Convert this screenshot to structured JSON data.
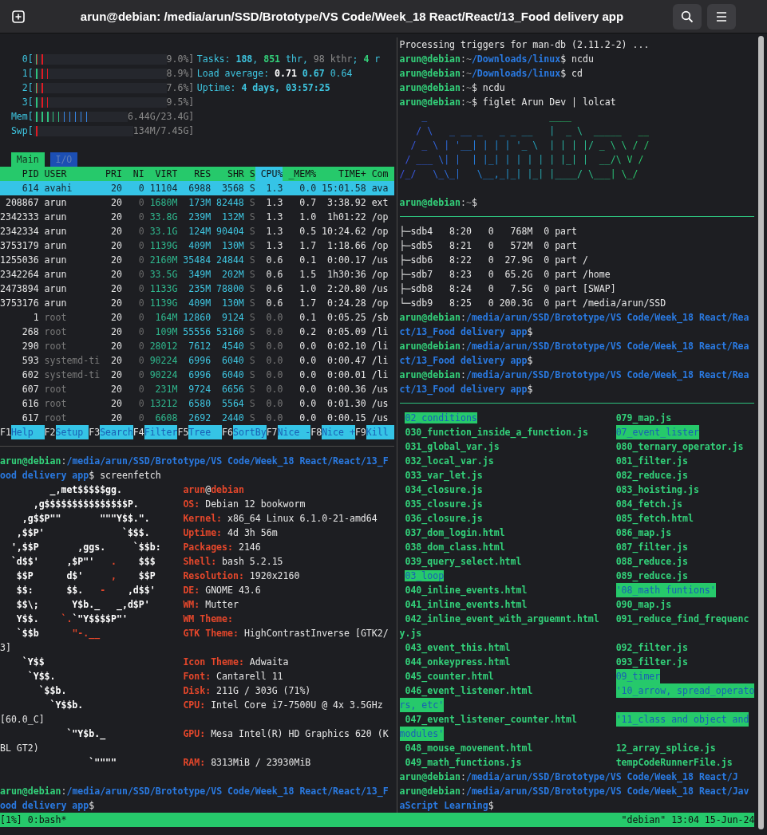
{
  "window": {
    "title": "arun@debian: /media/arun/SSD/Brototype/VS Code/Week_18 React/React/13_Food delivery app"
  },
  "htop": {
    "meters": [
      {
        "label": "0[",
        "kind": "cpu",
        "level": 0.09,
        "value": "9.0%]"
      },
      {
        "label": "1[",
        "kind": "cpu",
        "level": 0.11,
        "value": "8.9%]"
      },
      {
        "label": "2[",
        "kind": "cpu",
        "level": 0.08,
        "value": "7.6%]"
      },
      {
        "label": "3[",
        "kind": "cpu",
        "level": 0.11,
        "value": "9.5%]"
      },
      {
        "label": "Mem[",
        "kind": "mem",
        "level": 0.6,
        "value": "6.44G/23.4G]"
      },
      {
        "label": "Swp[",
        "kind": "swap",
        "level": 0.08,
        "value": "134M/7.45G]"
      }
    ],
    "info": [
      [
        {
          "kind": "cyan",
          "text": "Tasks: "
        },
        {
          "kind": "cyanb",
          "text": "188"
        },
        {
          "kind": "cyan",
          "text": ", "
        },
        {
          "kind": "greenb",
          "text": "851"
        },
        {
          "kind": "cyan",
          "text": " thr, "
        },
        {
          "kind": "dim",
          "text": "98 kthr"
        },
        {
          "kind": "cyan",
          "text": "; "
        },
        {
          "kind": "greenb",
          "text": "4"
        },
        {
          "kind": "cyan",
          "text": " r"
        }
      ],
      [
        {
          "kind": "cyan",
          "text": "Load average: "
        },
        {
          "kind": "whiteb",
          "text": "0.71"
        },
        {
          "kind": "cyanb",
          "text": " 0.67"
        },
        {
          "kind": "cyan",
          "text": " 0.64"
        }
      ],
      [
        {
          "kind": "cyan",
          "text": "Uptime: "
        },
        {
          "kind": "cyanb",
          "text": "4 days, 03:57:25"
        }
      ]
    ],
    "tabs": [
      {
        "label": "Main",
        "selected": true
      },
      {
        "label": "I/O",
        "selected": false
      }
    ],
    "columns": [
      {
        "label": "PID",
        "selected": false
      },
      {
        "label": "USER",
        "selected": false
      },
      {
        "label": "PRI",
        "selected": false
      },
      {
        "label": "NI",
        "selected": false
      },
      {
        "label": "VIRT",
        "selected": false
      },
      {
        "label": "RES",
        "selected": false
      },
      {
        "label": "SHR",
        "selected": false
      },
      {
        "label": "S",
        "selected": false
      },
      {
        "label": "CPU%",
        "selected": true
      },
      {
        "label": "_MEM%",
        "selected": false
      },
      {
        "label": "TIME+",
        "selected": false
      },
      {
        "label": "Com",
        "selected": false
      }
    ],
    "rows": [
      {
        "cells": [
          "614",
          "avahi",
          "20",
          "0",
          "11104",
          "6988",
          "3568",
          "S",
          "1.3",
          "0.0",
          "15:01.58",
          "ava"
        ],
        "selected": true,
        "dimmed": false
      },
      {
        "cells": [
          "208867",
          "arun",
          "20",
          "0",
          "1680M",
          "173M",
          "82448",
          "S",
          "1.3",
          "0.7",
          "3:38.92",
          "ext"
        ],
        "selected": false,
        "dimmed": false
      },
      {
        "cells": [
          "2342333",
          "arun",
          "20",
          "0",
          "33.8G",
          "239M",
          "132M",
          "S",
          "1.3",
          "1.0",
          "1h01:22",
          "/op"
        ],
        "selected": false,
        "dimmed": false
      },
      {
        "cells": [
          "2342334",
          "arun",
          "20",
          "0",
          "33.1G",
          "124M",
          "90404",
          "S",
          "1.3",
          "0.5",
          "10:24.62",
          "/op"
        ],
        "selected": false,
        "dimmed": false
      },
      {
        "cells": [
          "3753179",
          "arun",
          "20",
          "0",
          "1139G",
          "409M",
          "130M",
          "S",
          "1.3",
          "1.7",
          "1:18.66",
          "/op"
        ],
        "selected": false,
        "dimmed": false
      },
      {
        "cells": [
          "1255036",
          "arun",
          "20",
          "0",
          "2160M",
          "35484",
          "24844",
          "S",
          "0.6",
          "0.1",
          "0:00.17",
          "/us"
        ],
        "selected": false,
        "dimmed": false
      },
      {
        "cells": [
          "2342264",
          "arun",
          "20",
          "0",
          "33.5G",
          "349M",
          "202M",
          "S",
          "0.6",
          "1.5",
          "1h30:36",
          "/op"
        ],
        "selected": false,
        "dimmed": false
      },
      {
        "cells": [
          "2473894",
          "arun",
          "20",
          "0",
          "1133G",
          "235M",
          "78800",
          "S",
          "0.6",
          "1.0",
          "2:20.80",
          "/us"
        ],
        "selected": false,
        "dimmed": false
      },
      {
        "cells": [
          "3753176",
          "arun",
          "20",
          "0",
          "1139G",
          "409M",
          "130M",
          "S",
          "0.6",
          "1.7",
          "0:24.28",
          "/op"
        ],
        "selected": false,
        "dimmed": false
      },
      {
        "cells": [
          "1",
          "root",
          "20",
          "0",
          "164M",
          "12860",
          "9124",
          "S",
          "0.0",
          "0.1",
          "0:05.25",
          "/sb"
        ],
        "selected": false,
        "dimmed": true
      },
      {
        "cells": [
          "268",
          "root",
          "20",
          "0",
          "109M",
          "55556",
          "53160",
          "S",
          "0.0",
          "0.2",
          "0:05.09",
          "/li"
        ],
        "selected": false,
        "dimmed": true
      },
      {
        "cells": [
          "290",
          "root",
          "20",
          "0",
          "28012",
          "7612",
          "4540",
          "S",
          "0.0",
          "0.0",
          "0:02.10",
          "/li"
        ],
        "selected": false,
        "dimmed": true
      },
      {
        "cells": [
          "593",
          "systemd-ti",
          "20",
          "0",
          "90224",
          "6996",
          "6040",
          "S",
          "0.0",
          "0.0",
          "0:00.47",
          "/li"
        ],
        "selected": false,
        "dimmed": true
      },
      {
        "cells": [
          "602",
          "systemd-ti",
          "20",
          "0",
          "90224",
          "6996",
          "6040",
          "S",
          "0.0",
          "0.0",
          "0:00.01",
          "/li"
        ],
        "selected": false,
        "dimmed": true
      },
      {
        "cells": [
          "607",
          "root",
          "20",
          "0",
          "231M",
          "9724",
          "6656",
          "S",
          "0.0",
          "0.0",
          "0:00.36",
          "/us"
        ],
        "selected": false,
        "dimmed": true
      },
      {
        "cells": [
          "616",
          "root",
          "20",
          "0",
          "13212",
          "6580",
          "5564",
          "S",
          "0.0",
          "0.0",
          "0:01.30",
          "/us"
        ],
        "selected": false,
        "dimmed": true
      },
      {
        "cells": [
          "617",
          "root",
          "20",
          "0",
          "6608",
          "2692",
          "2440",
          "S",
          "0.0",
          "0.0",
          "0:00.15",
          "/us"
        ],
        "selected": false,
        "dimmed": true
      }
    ],
    "keys": [
      {
        "key": "F1",
        "label": "Help"
      },
      {
        "key": "F2",
        "label": "Setup"
      },
      {
        "key": "F3",
        "label": "Search"
      },
      {
        "key": "F4",
        "label": "Filter"
      },
      {
        "key": "F5",
        "label": "Tree"
      },
      {
        "key": "F6",
        "label": "SortBy"
      },
      {
        "key": "F7",
        "label": "Nice -"
      },
      {
        "key": "F8",
        "label": "Nice +"
      },
      {
        "key": "F9",
        "label": "Kill"
      }
    ]
  },
  "left_bottom": {
    "lines": [
      {
        "kind": "text",
        "segs": [
          {
            "kind": "user",
            "text": "arun@debian"
          },
          {
            "kind": "sep",
            "text": ":"
          },
          {
            "kind": "path",
            "text": "/media/arun/SSD/Brototype/VS Code/Week_18 React/React/13_F"
          }
        ]
      },
      {
        "kind": "text",
        "segs": [
          {
            "kind": "path",
            "text": "ood delivery app"
          },
          {
            "kind": "plain",
            "text": "$ screenfetch"
          }
        ]
      },
      {
        "kind": "split",
        "art": [
          {
            "kind": "art",
            "text": "         _,met$$$$$gg."
          }
        ],
        "info": [
          {
            "kind": "redb",
            "text": "arun"
          },
          {
            "kind": "plain",
            "text": "@"
          },
          {
            "kind": "redb",
            "text": "debian"
          }
        ]
      },
      {
        "kind": "split",
        "art": [
          {
            "kind": "art",
            "text": "      ,g$$$$$$$$$$$$$$$P."
          }
        ],
        "info": [
          {
            "kind": "redb",
            "text": "OS:"
          },
          {
            "kind": "plain",
            "text": " Debian 12 bookworm"
          }
        ]
      },
      {
        "kind": "split",
        "art": [
          {
            "kind": "art",
            "text": "    ,g$$P\"\"       \"\"\"Y$$.\"."
          }
        ],
        "info": [
          {
            "kind": "redb",
            "text": "Kernel:"
          },
          {
            "kind": "plain",
            "text": " x86_64 Linux 6.1.0-21-amd64"
          }
        ]
      },
      {
        "kind": "split",
        "art": [
          {
            "kind": "art",
            "text": "   ,$$P'              `$$$."
          }
        ],
        "info": [
          {
            "kind": "redb",
            "text": "Uptime:"
          },
          {
            "kind": "plain",
            "text": " 4d 3h 56m"
          }
        ]
      },
      {
        "kind": "split",
        "art": [
          {
            "kind": "art",
            "text": "  ',$$P       ,ggs.     `$$b:"
          }
        ],
        "info": [
          {
            "kind": "redb",
            "text": "Packages:"
          },
          {
            "kind": "plain",
            "text": " 2146"
          }
        ]
      },
      {
        "kind": "split",
        "art": [
          {
            "kind": "art",
            "text": "  `d$$'     ,$P\"'   "
          },
          {
            "kind": "artred",
            "text": "."
          },
          {
            "kind": "art",
            "text": "    $$$"
          }
        ],
        "info": [
          {
            "kind": "redb",
            "text": "Shell:"
          },
          {
            "kind": "plain",
            "text": " bash 5.2.15"
          }
        ]
      },
      {
        "kind": "split",
        "art": [
          {
            "kind": "art",
            "text": "   $$P      d$'     "
          },
          {
            "kind": "artred",
            "text": ","
          },
          {
            "kind": "art",
            "text": "    $$P"
          }
        ],
        "info": [
          {
            "kind": "redb",
            "text": "Resolution:"
          },
          {
            "kind": "plain",
            "text": " 1920x2160"
          }
        ]
      },
      {
        "kind": "split",
        "art": [
          {
            "kind": "art",
            "text": "   $$:      $$.   "
          },
          {
            "kind": "artred",
            "text": "-"
          },
          {
            "kind": "art",
            "text": "    ,d$$'"
          }
        ],
        "info": [
          {
            "kind": "redb",
            "text": "DE:"
          },
          {
            "kind": "plain",
            "text": " GNOME 43.6"
          }
        ]
      },
      {
        "kind": "split",
        "art": [
          {
            "kind": "art",
            "text": "   $$\\;      Y$b._   _,d$P'"
          }
        ],
        "info": [
          {
            "kind": "redb",
            "text": "WM:"
          },
          {
            "kind": "plain",
            "text": " Mutter"
          }
        ]
      },
      {
        "kind": "split",
        "art": [
          {
            "kind": "art",
            "text": "   Y$$.    "
          },
          {
            "kind": "artred",
            "text": "`."
          },
          {
            "kind": "art",
            "text": "`\"Y$$$$P\"'"
          }
        ],
        "info": [
          {
            "kind": "redb",
            "text": "WM Theme:"
          }
        ]
      },
      {
        "kind": "split",
        "art": [
          {
            "kind": "art",
            "text": "   `$$b      "
          },
          {
            "kind": "artred",
            "text": "\"-.__"
          }
        ],
        "info": [
          {
            "kind": "redb",
            "text": "GTK Theme:"
          },
          {
            "kind": "plain",
            "text": " HighContrastInverse [GTK2/"
          }
        ]
      },
      {
        "kind": "text",
        "segs": [
          {
            "kind": "plain",
            "text": "3]"
          }
        ]
      },
      {
        "kind": "split",
        "art": [
          {
            "kind": "art",
            "text": "    `Y$$"
          }
        ],
        "info": [
          {
            "kind": "redb",
            "text": "Icon Theme:"
          },
          {
            "kind": "plain",
            "text": " Adwaita"
          }
        ]
      },
      {
        "kind": "split",
        "art": [
          {
            "kind": "art",
            "text": "     `Y$$."
          }
        ],
        "info": [
          {
            "kind": "redb",
            "text": "Font:"
          },
          {
            "kind": "plain",
            "text": " Cantarell 11"
          }
        ]
      },
      {
        "kind": "split",
        "art": [
          {
            "kind": "art",
            "text": "       `$$b."
          }
        ],
        "info": [
          {
            "kind": "redb",
            "text": "Disk:"
          },
          {
            "kind": "plain",
            "text": " 211G / 303G (71%)"
          }
        ]
      },
      {
        "kind": "split",
        "art": [
          {
            "kind": "art",
            "text": "         `Y$$b."
          }
        ],
        "info": [
          {
            "kind": "redb",
            "text": "CPU:"
          },
          {
            "kind": "plain",
            "text": " Intel Core i7-7500U @ 4x 3.5GHz"
          }
        ]
      },
      {
        "kind": "text",
        "segs": [
          {
            "kind": "plain",
            "text": "[60.0_C]"
          }
        ]
      },
      {
        "kind": "split",
        "art": [
          {
            "kind": "art",
            "text": "            `\"Y$b._"
          }
        ],
        "info": [
          {
            "kind": "redb",
            "text": "GPU:"
          },
          {
            "kind": "plain",
            "text": " Mesa Intel(R) HD Graphics 620 (K"
          }
        ]
      },
      {
        "kind": "text",
        "segs": [
          {
            "kind": "plain",
            "text": "BL GT2)"
          }
        ]
      },
      {
        "kind": "split",
        "art": [
          {
            "kind": "art",
            "text": "                `\"\"\"\""
          }
        ],
        "info": [
          {
            "kind": "redb",
            "text": "RAM:"
          },
          {
            "kind": "plain",
            "text": " 8313MiB / 23930MiB"
          }
        ]
      },
      {
        "kind": "blank"
      },
      {
        "kind": "text",
        "segs": [
          {
            "kind": "user",
            "text": "arun@debian"
          },
          {
            "kind": "sep",
            "text": ":"
          },
          {
            "kind": "path",
            "text": "/media/arun/SSD/Brototype/VS Code/Week_18 React/React/13_F"
          }
        ]
      },
      {
        "kind": "text",
        "segs": [
          {
            "kind": "path",
            "text": "ood delivery app"
          },
          {
            "kind": "plain",
            "text": "$"
          }
        ]
      }
    ]
  },
  "right_top": {
    "lines": [
      {
        "kind": "text",
        "segs": [
          {
            "kind": "plain",
            "text": "Processing triggers for man-db (2.11.2-2) ..."
          }
        ]
      },
      {
        "kind": "text",
        "segs": [
          {
            "kind": "user",
            "text": "arun@debian"
          },
          {
            "kind": "sep",
            "text": ":"
          },
          {
            "kind": "dim",
            "text": "~"
          },
          {
            "kind": "path",
            "text": "/Downloads/linux"
          },
          {
            "kind": "plain",
            "text": "$ ncdu"
          }
        ]
      },
      {
        "kind": "text",
        "segs": [
          {
            "kind": "user",
            "text": "arun@debian"
          },
          {
            "kind": "sep",
            "text": ":"
          },
          {
            "kind": "dim",
            "text": "~"
          },
          {
            "kind": "path",
            "text": "/Downloads/linux"
          },
          {
            "kind": "plain",
            "text": "$ cd"
          }
        ]
      },
      {
        "kind": "text",
        "segs": [
          {
            "kind": "user",
            "text": "arun@debian"
          },
          {
            "kind": "sep",
            "text": ":"
          },
          {
            "kind": "dim",
            "text": "~"
          },
          {
            "kind": "plain",
            "text": "$ ncdu"
          }
        ]
      },
      {
        "kind": "text",
        "segs": [
          {
            "kind": "user",
            "text": "arun@debian"
          },
          {
            "kind": "sep",
            "text": ":"
          },
          {
            "kind": "dim",
            "text": "~"
          },
          {
            "kind": "plain",
            "text": "$ figlet Arun Dev | lolcat"
          }
        ]
      },
      {
        "kind": "figlet",
        "text": "    _                      ____"
      },
      {
        "kind": "figlet",
        "text": "   / \\   _ __ _   _ _ __   |  _ \\  _____   __"
      },
      {
        "kind": "figlet",
        "text": "  / _ \\ | '__| | | | '_ \\  | | | |/ _ \\ \\ / /"
      },
      {
        "kind": "figlet",
        "text": " / ___ \\| |  | |_| | | | | | |_| |  __/\\ V /"
      },
      {
        "kind": "figlet",
        "text": "/_/   \\_\\_|   \\__,_|_| |_| |____/ \\___| \\_/"
      },
      {
        "kind": "blank"
      },
      {
        "kind": "text",
        "segs": [
          {
            "kind": "user",
            "text": "arun@debian"
          },
          {
            "kind": "sep",
            "text": ":"
          },
          {
            "kind": "dim",
            "text": "~"
          },
          {
            "kind": "plain",
            "text": "$"
          }
        ]
      }
    ]
  },
  "right_middle": {
    "lines": [
      {
        "kind": "text",
        "segs": [
          {
            "kind": "plain",
            "text": "├─sdb4   8:20   0   768M  0 part"
          }
        ]
      },
      {
        "kind": "text",
        "segs": [
          {
            "kind": "plain",
            "text": "├─sdb5   8:21   0   572M  0 part"
          }
        ]
      },
      {
        "kind": "text",
        "segs": [
          {
            "kind": "plain",
            "text": "├─sdb6   8:22   0  27.9G  0 part /"
          }
        ]
      },
      {
        "kind": "text",
        "segs": [
          {
            "kind": "plain",
            "text": "├─sdb7   8:23   0  65.2G  0 part /home"
          }
        ]
      },
      {
        "kind": "text",
        "segs": [
          {
            "kind": "plain",
            "text": "├─sdb8   8:24   0   7.5G  0 part [SWAP]"
          }
        ]
      },
      {
        "kind": "text",
        "segs": [
          {
            "kind": "plain",
            "text": "└─sdb9   8:25   0 200.3G  0 part /media/arun/SSD"
          }
        ]
      },
      {
        "kind": "text",
        "segs": [
          {
            "kind": "user",
            "text": "arun@debian"
          },
          {
            "kind": "sep",
            "text": ":"
          },
          {
            "kind": "path",
            "text": "/media/arun/SSD/Brototype/VS Code/Week_18 React/Rea"
          }
        ]
      },
      {
        "kind": "text",
        "segs": [
          {
            "kind": "path",
            "text": "ct/13_Food delivery app"
          },
          {
            "kind": "plain",
            "text": "$"
          }
        ]
      },
      {
        "kind": "text",
        "segs": [
          {
            "kind": "user",
            "text": "arun@debian"
          },
          {
            "kind": "sep",
            "text": ":"
          },
          {
            "kind": "path",
            "text": "/media/arun/SSD/Brototype/VS Code/Week_18 React/Rea"
          }
        ]
      },
      {
        "kind": "text",
        "segs": [
          {
            "kind": "path",
            "text": "ct/13_Food delivery app"
          },
          {
            "kind": "plain",
            "text": "$"
          }
        ]
      },
      {
        "kind": "text",
        "segs": [
          {
            "kind": "user",
            "text": "arun@debian"
          },
          {
            "kind": "sep",
            "text": ":"
          },
          {
            "kind": "path",
            "text": "/media/arun/SSD/Brototype/VS Code/Week_18 React/Rea"
          }
        ]
      },
      {
        "kind": "text",
        "segs": [
          {
            "kind": "path",
            "text": "ct/13_Food delivery app"
          },
          {
            "kind": "plain",
            "text": "$"
          }
        ]
      }
    ]
  },
  "right_bottom": {
    "listing": [
      {
        "kind": "row",
        "left": {
          "name": "02_conditions",
          "kind": "dir"
        },
        "right": {
          "name": "079_map.js",
          "kind": "file"
        }
      },
      {
        "kind": "row",
        "left": {
          "name": "030_function_inside_a_function.js",
          "kind": "file"
        },
        "right": {
          "name": "07_event_lister",
          "kind": "dir"
        }
      },
      {
        "kind": "row",
        "left": {
          "name": "031_global_var.js",
          "kind": "file"
        },
        "right": {
          "name": "080_ternary_operator.js",
          "kind": "file"
        }
      },
      {
        "kind": "row",
        "left": {
          "name": "032_local_var.js",
          "kind": "file"
        },
        "right": {
          "name": "081_filter.js",
          "kind": "file"
        }
      },
      {
        "kind": "row",
        "left": {
          "name": "033_var_let.js",
          "kind": "file"
        },
        "right": {
          "name": "082_reduce.js",
          "kind": "file"
        }
      },
      {
        "kind": "row",
        "left": {
          "name": "034_closure.js",
          "kind": "file"
        },
        "right": {
          "name": "083_hoisting.js",
          "kind": "file"
        }
      },
      {
        "kind": "row",
        "left": {
          "name": "035_closure.js",
          "kind": "file"
        },
        "right": {
          "name": "084_fetch.js",
          "kind": "file"
        }
      },
      {
        "kind": "row",
        "left": {
          "name": "036_closure.js",
          "kind": "file"
        },
        "right": {
          "name": "085_fetch.html",
          "kind": "file"
        }
      },
      {
        "kind": "row",
        "left": {
          "name": "037_dom_login.html",
          "kind": "file"
        },
        "right": {
          "name": "086_map.js",
          "kind": "file"
        }
      },
      {
        "kind": "row",
        "left": {
          "name": "038_dom_class.html",
          "kind": "file"
        },
        "right": {
          "name": "087_filter.js",
          "kind": "file"
        }
      },
      {
        "kind": "row",
        "left": {
          "name": "039_query_select.html",
          "kind": "file"
        },
        "right": {
          "name": "088_reduce.js",
          "kind": "file"
        }
      },
      {
        "kind": "row",
        "left": {
          "name": "03_loop",
          "kind": "dir"
        },
        "right": {
          "name": "089_reduce.js",
          "kind": "file"
        }
      },
      {
        "kind": "row",
        "left": {
          "name": "040_inline_events.html",
          "kind": "file"
        },
        "right": {
          "name": "'08_math funtions'",
          "kind": "dir"
        }
      },
      {
        "kind": "row",
        "left": {
          "name": "041_inline_events.html",
          "kind": "file"
        },
        "right": {
          "name": "090_map.js",
          "kind": "file"
        }
      },
      {
        "kind": "row",
        "left": {
          "name": "042_inline_event_with_arguemnt.html",
          "kind": "file"
        },
        "right": {
          "name": "091_reduce_find_frequenc",
          "kind": "file"
        }
      },
      {
        "kind": "wrap",
        "left": {
          "name": "y.js",
          "kind": "file"
        }
      },
      {
        "kind": "row",
        "left": {
          "name": "043_event_this.html",
          "kind": "file"
        },
        "right": {
          "name": "092_filter.js",
          "kind": "file"
        }
      },
      {
        "kind": "row",
        "left": {
          "name": "044_onkeypress.html",
          "kind": "file"
        },
        "right": {
          "name": "093_filter.js",
          "kind": "file"
        }
      },
      {
        "kind": "row",
        "left": {
          "name": "045_counter.html",
          "kind": "file"
        },
        "right": {
          "name": "09_timer",
          "kind": "dir"
        }
      },
      {
        "kind": "row",
        "left": {
          "name": "046_event_listener.html",
          "kind": "file"
        },
        "right": {
          "name": "'10_arrow, spread_operato",
          "kind": "dir"
        }
      },
      {
        "kind": "wrap",
        "left": {
          "name": "rs, etc'",
          "kind": "dir"
        }
      },
      {
        "kind": "row",
        "left": {
          "name": "047_event_listener_counter.html",
          "kind": "file"
        },
        "right": {
          "name": "'11_class and object and",
          "kind": "dir"
        }
      },
      {
        "kind": "wrap",
        "left": {
          "name": "modules'",
          "kind": "dir"
        }
      },
      {
        "kind": "row",
        "left": {
          "name": "048_mouse_movement.html",
          "kind": "file"
        },
        "right": {
          "name": "12_array_splice.js",
          "kind": "file"
        }
      },
      {
        "kind": "row",
        "left": {
          "name": "049_math_functions.js",
          "kind": "file"
        },
        "right": {
          "name": "tempCodeRunnerFile.js",
          "kind": "file"
        }
      }
    ],
    "lines": [
      {
        "kind": "text",
        "segs": [
          {
            "kind": "user",
            "text": "arun@debian"
          },
          {
            "kind": "sep",
            "text": ":"
          },
          {
            "kind": "path",
            "text": "/media/arun/SSD/Brototype/VS Code/Week_18 React/J"
          }
        ]
      },
      {
        "kind": "text",
        "segs": [
          {
            "kind": "user",
            "text": "arun@debian"
          },
          {
            "kind": "sep",
            "text": ":"
          },
          {
            "kind": "path",
            "text": "/media/arun/SSD/Brototype/VS Code/Week_18 React/Jav"
          }
        ]
      },
      {
        "kind": "text",
        "segs": [
          {
            "kind": "path",
            "text": "aScript Learning"
          },
          {
            "kind": "plain",
            "text": "$"
          }
        ]
      }
    ]
  },
  "status_bar": {
    "left": "[1%] 0:bash*",
    "right": "\"debian\" 13:04 15-Jun-24"
  }
}
